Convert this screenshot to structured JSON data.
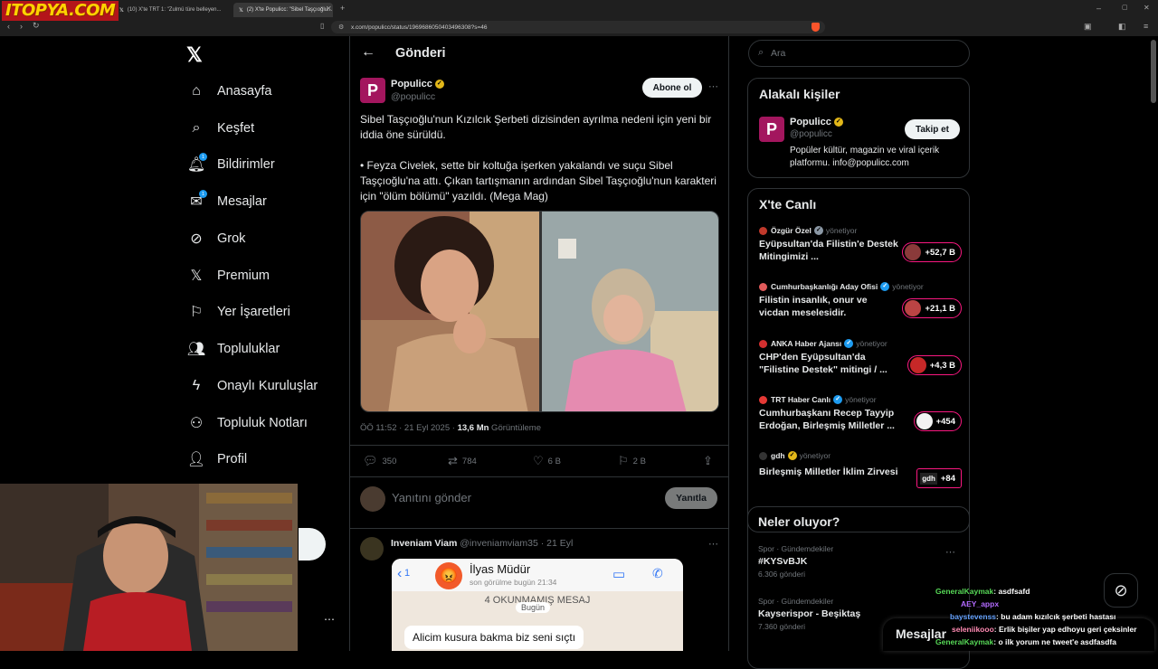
{
  "browser": {
    "site_logo": "ITOPYA.COM",
    "tabs": [
      {
        "label": "(10) X'te TRT 1: \"Zulmü türe belleyen..."
      },
      {
        "label": "(2) X'te Populicc: \"Sibel Taşçıoğlu..."
      }
    ],
    "url": "x.com/populicc/status/1969686050403496308?s=46"
  },
  "nav": {
    "items": [
      {
        "label": "Anasayfa",
        "icon": "home-icon"
      },
      {
        "label": "Keşfet",
        "icon": "search-icon"
      },
      {
        "label": "Bildirimler",
        "icon": "bell-icon",
        "badge": "1"
      },
      {
        "label": "Mesajlar",
        "icon": "mail-icon",
        "badge": "1"
      },
      {
        "label": "Grok",
        "icon": "grok-icon"
      },
      {
        "label": "Premium",
        "icon": "x-logo-icon"
      },
      {
        "label": "Yer İşaretleri",
        "icon": "bookmark-icon"
      },
      {
        "label": "Topluluklar",
        "icon": "communities-icon"
      },
      {
        "label": "Onaylı Kuruluşlar",
        "icon": "lightning-icon"
      },
      {
        "label": "Topluluk Notları",
        "icon": "community-notes-icon"
      },
      {
        "label": "Profil",
        "icon": "person-icon"
      }
    ]
  },
  "main": {
    "header_title": "Gönderi",
    "author": {
      "name": "Populicc",
      "handle": "@populicc",
      "follow_label": "Abone ol"
    },
    "text": "Sibel Taşçıoğlu'nun Kızılcık Şerbeti dizisinden ayrılma nedeni için yeni bir iddia öne sürüldü.\n\n• Feyza Civelek, sette bir koltuğa işerken yakalandı ve suçu Sibel Taşçıoğlu'na attı. Çıkan tartışmanın ardından Sibel Taşçıoğlu'nun karakteri için \"ölüm bölümü\" yazıldı. (Mega Mag)",
    "meta": {
      "time": "ÖÖ 11:52 · 21 Eyl 2025 · ",
      "views": "13,6 Mn",
      "views_label": " Görüntüleme"
    },
    "stats": {
      "replies": "350",
      "reposts": "784",
      "likes": "6 B",
      "bookmarks": "2 B"
    },
    "reply_box": {
      "placeholder": "Yanıtını gönder",
      "button": "Yanıtla"
    },
    "reply": {
      "name": "Inveniam Viam",
      "handle": "@inveniamviam35 · 21 Eyl",
      "chat_name": "İlyas Müdür",
      "chat_status": "son görülme bugün 21:34",
      "unread": "4 OKUNMAMIŞ MESAJ",
      "day": "Bugün",
      "message": "Alicim kusura bakma biz seni sıçtı"
    }
  },
  "right": {
    "search_placeholder": "Ara",
    "related": {
      "title": "Alakalı kişiler",
      "name": "Populicc",
      "handle": "@populicc",
      "bio": "Popüler kültür, magazin ve viral içerik platformu. info@populicc.com",
      "follow_label": "Takip et"
    },
    "live": {
      "title": "X'te Canlı",
      "hosting": "yönetiyor",
      "items": [
        {
          "host": "Özgür Özel",
          "title": "Eyüpsultan'da Filistin'e Destek Mitingimizi ...",
          "count": "+52,7 B",
          "verified": "gray"
        },
        {
          "host": "Cumhurbaşkanlığı Aday Ofisi",
          "title": "Filistin insanlık, onur ve vicdan meselesidir.",
          "count": "+21,1 B",
          "verified": "blue"
        },
        {
          "host": "ANKA Haber Ajansı",
          "title": "CHP'den Eyüpsultan'da \"Filistine Destek\" mitingi / ...",
          "count": "+4,3 B",
          "verified": "blue"
        },
        {
          "host": "TRT Haber Canlı",
          "title": "Cumhurbaşkanı Recep Tayyip Erdoğan, Birleşmiş Milletler ...",
          "count": "+454",
          "verified": "blue"
        },
        {
          "host": "gdh",
          "title": "Birleşmiş Milletler İklim Zirvesi",
          "count": "+84",
          "verified": "gold",
          "avatar_text": "gdh"
        }
      ]
    },
    "trends": {
      "title": "Neler oluyor?",
      "items": [
        {
          "category": "Spor · Gündemdekiler",
          "name": "#KYSvBJK",
          "count": "6.306 gönderi"
        },
        {
          "category": "Spor · Gündemdekiler",
          "name": "Kayserispor - Beşiktaş",
          "count": "7.360 gönderi"
        }
      ]
    },
    "messages_label": "Mesajlar"
  },
  "chat": {
    "lines": [
      {
        "user": "GeneralKaymak",
        "text": "asdfsafd",
        "color": "#57d957"
      },
      {
        "user": "AEY_appx",
        "text": "",
        "color": "#b36bff"
      },
      {
        "user": "baystevenss",
        "text": "bu adam kızılcık şerbeti hastası",
        "color": "#66a3ff"
      },
      {
        "user": "seleniikooo",
        "text": "Erlik bişiler yap edhoyu geri çeksinler",
        "color": "#ff8ab3"
      },
      {
        "user": "GeneralKaymak",
        "text": "o ilk yorum ne tweet'e asdfasdfa",
        "color": "#57d957"
      }
    ]
  },
  "colors": {
    "accent": "#1d9bf0",
    "brand": "#a3165e",
    "live": "#f91880"
  }
}
